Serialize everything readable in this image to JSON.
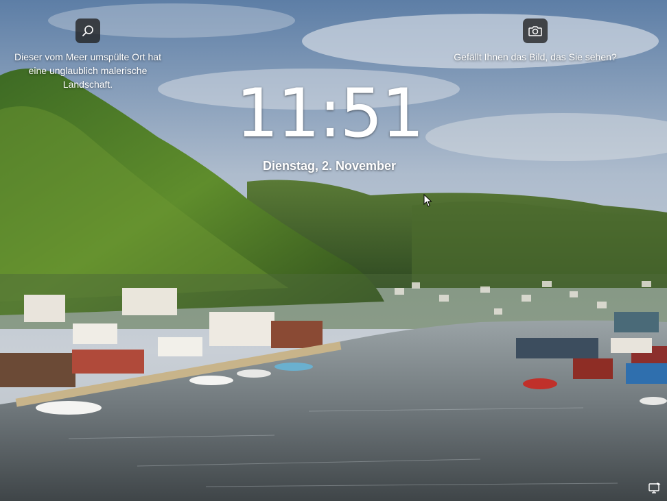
{
  "lockscreen": {
    "spotlight_caption": "Dieser vom Meer umspülte Ort hat eine unglaublich malerische Landschaft.",
    "feedback_prompt": "Gefällt Ihnen das Bild, das Sie sehen?",
    "time": "11:51",
    "date": "Dienstag, 2. November"
  },
  "icons": {
    "search": "search-icon",
    "camera": "camera-icon",
    "network": "network-status-icon"
  },
  "colors": {
    "icon_button_bg": "#202020",
    "text": "#ffffff"
  }
}
